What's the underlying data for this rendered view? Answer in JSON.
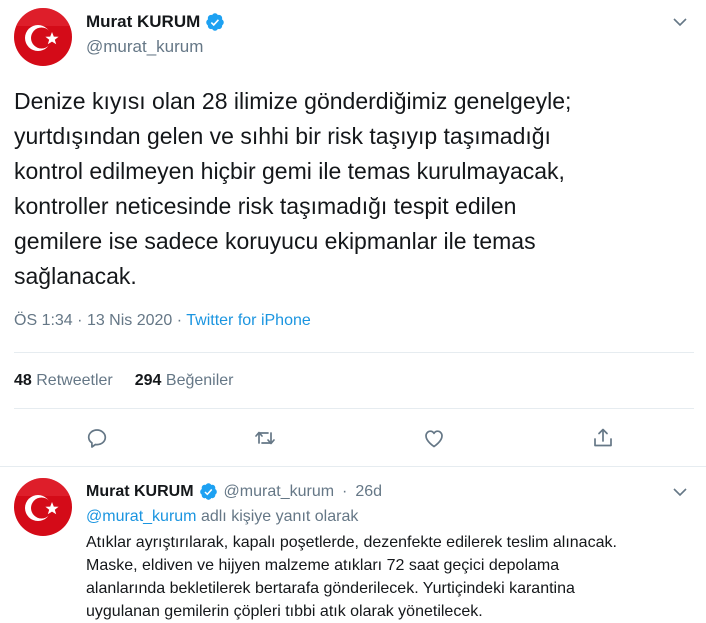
{
  "main_tweet": {
    "display_name": "Murat KURUM",
    "handle": "@murat_kurum",
    "text": "Denize kıyısı olan 28 ilimize gönderdiğimiz genelgeyle;\nyurtdışından gelen ve sıhhi bir risk taşıyıp taşımadığı\nkontrol edilmeyen hiçbir gemi ile temas kurulmayacak,\nkontroller neticesinde risk taşımadığı tespit edilen\ngemilere ise sadece koruyucu ekipmanlar ile temas\nsağlanacak.",
    "time": "ÖS 1:34",
    "date": "13 Nis 2020",
    "dot": "·",
    "source": "Twitter for iPhone",
    "retweet_count": "48",
    "retweet_label": "Retweetler",
    "like_count": "294",
    "like_label": "Beğeniler",
    "actions": [
      "reply-icon",
      "retweet-icon",
      "like-icon",
      "share-icon"
    ]
  },
  "reply_tweet": {
    "display_name": "Murat KURUM",
    "handle": "@murat_kurum",
    "dot": "·",
    "age": "26d",
    "reply_mention": "@murat_kurum",
    "reply_suffix": "adlı kişiye yanıt olarak",
    "lines": [
      "Atıklar ayrıştırılarak, kapalı poşetlerde, dezenfekte edilerek teslim alınacak.",
      "Maske, eldiven ve hijyen malzeme atıkları 72 saat geçici depolama",
      "alanlarında bekletilerek bertarafa gönderilecek. Yurtiçindeki karantina",
      "uygulanan gemilerin çöpleri tıbbi atık olarak yönetilecek."
    ]
  },
  "colors": {
    "accent": "#1da1f2",
    "link": "#1b95e0",
    "secondary_text": "#657786",
    "flag_red": "#e30a17",
    "divider": "#e6ecf0"
  }
}
